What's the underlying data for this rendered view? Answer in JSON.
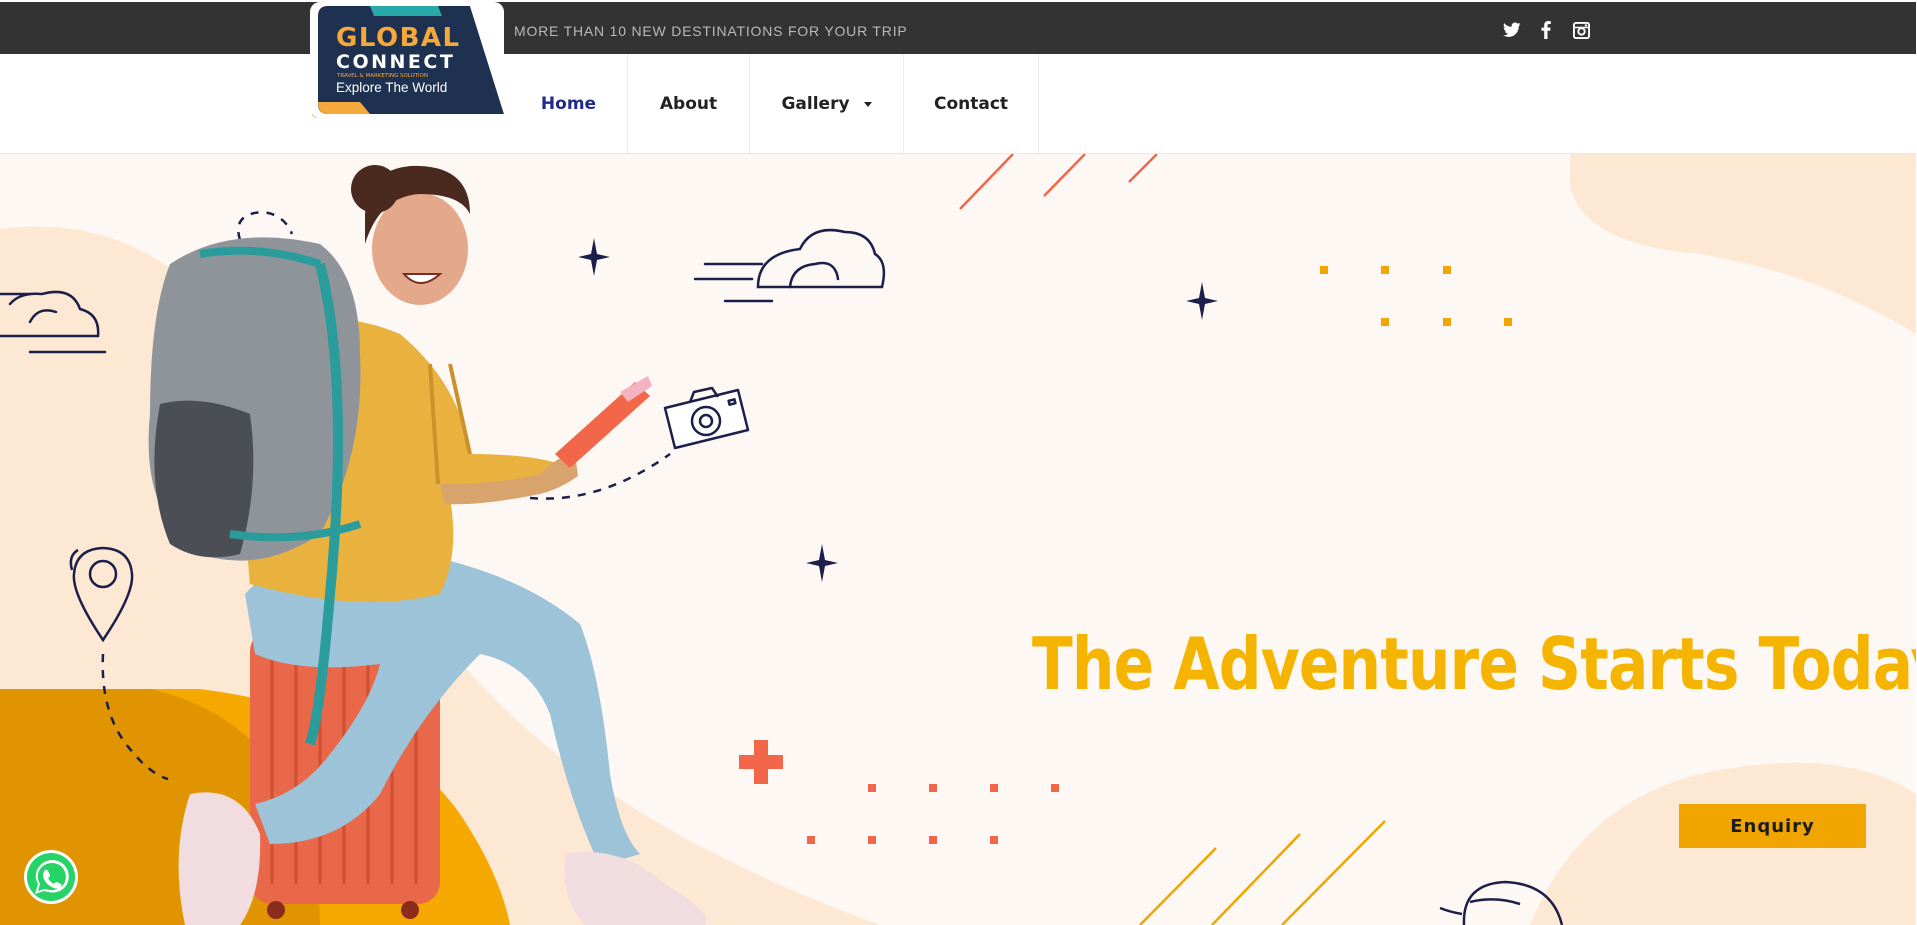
{
  "topbar": {
    "tagline": "MORE THAN 10 NEW DESTINATIONS FOR YOUR TRIP",
    "social_icons": [
      "twitter-icon",
      "facebook-icon",
      "instagram-icon"
    ]
  },
  "logo": {
    "line1": "GLOBAL",
    "line2": "CONNECT",
    "line3": "TRAVEL & MARKETING SOLUTION",
    "line4": "Explore The World"
  },
  "nav": {
    "items": [
      {
        "label": "Home",
        "active": true
      },
      {
        "label": "About",
        "active": false
      },
      {
        "label": "Gallery",
        "active": false,
        "dropdown": true
      },
      {
        "label": "Contact",
        "active": false
      }
    ]
  },
  "hero": {
    "headline": "The Adventure Starts Today",
    "cta_label": "Enquiry"
  },
  "colors": {
    "accent": "#f5b400",
    "button": "#f0a500",
    "topbar": "#333333",
    "nav_active": "#1f2a8c",
    "coral": "#f26649"
  },
  "floating": {
    "whatsapp": "whatsapp-icon"
  }
}
